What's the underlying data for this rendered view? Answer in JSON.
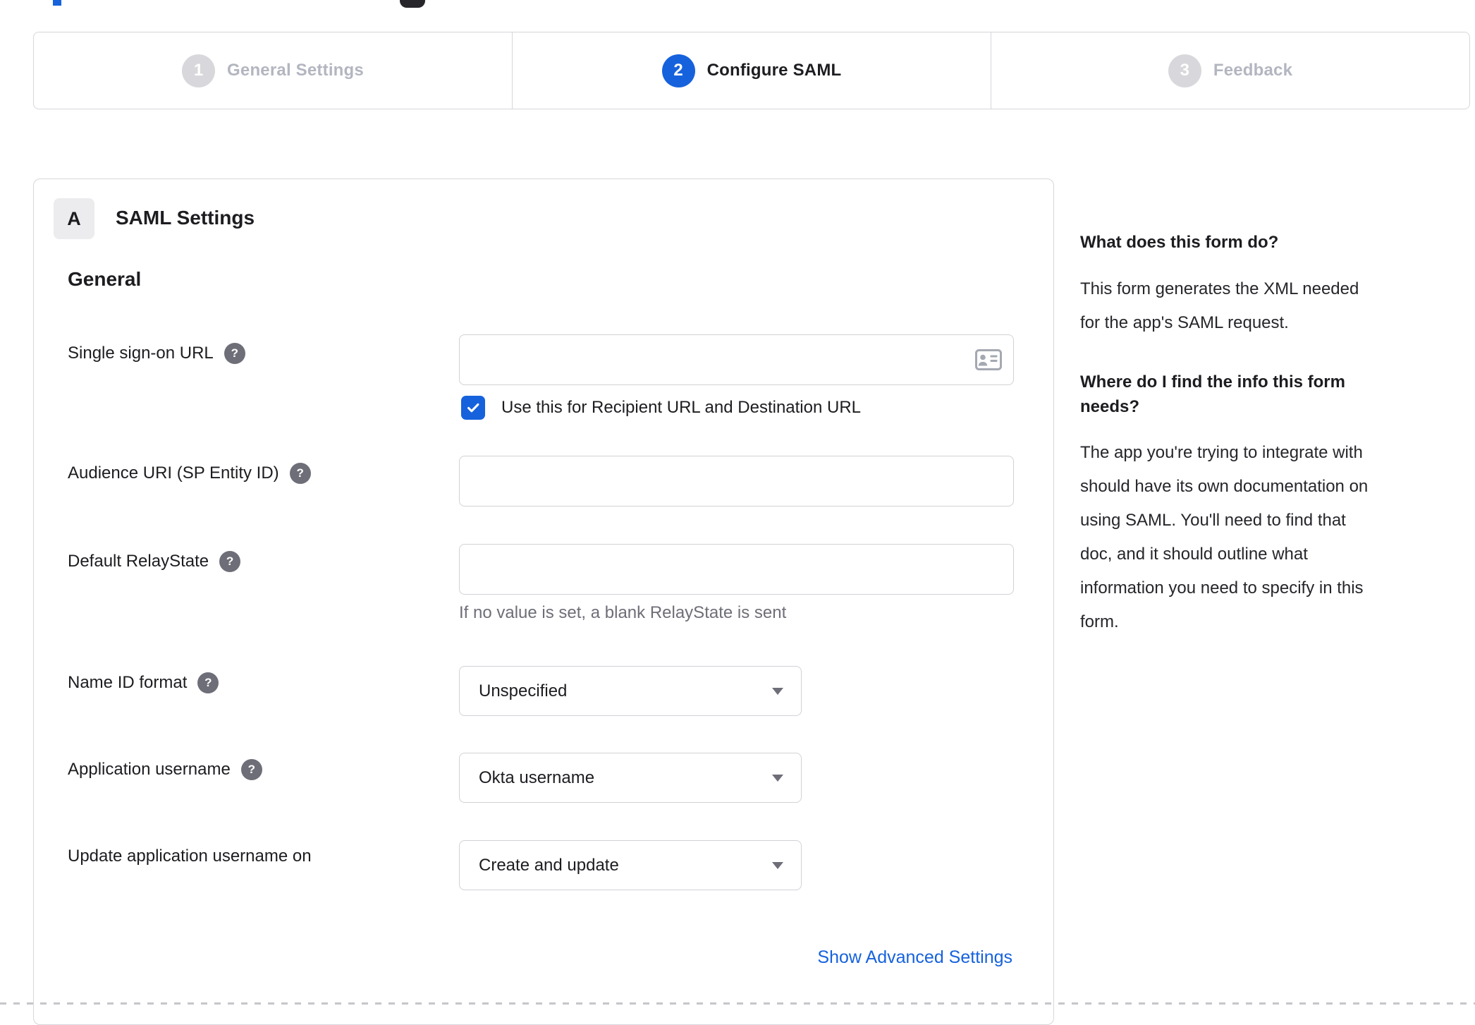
{
  "colors": {
    "accent_blue": "#1662dd",
    "text_dark": "#1d1d21",
    "muted_gray": "#6e6e78",
    "border_gray": "#d7d7dc",
    "inactive_gray": "#b3b6c0"
  },
  "stepper": {
    "active_step": "2",
    "steps": [
      {
        "number": "1",
        "label": "General Settings"
      },
      {
        "number": "2",
        "label": "Configure SAML"
      },
      {
        "number": "3",
        "label": "Feedback"
      }
    ]
  },
  "saml_panel": {
    "badge": "A",
    "title": "SAML Settings",
    "section_heading": "General",
    "sso_url": {
      "label": "Single sign-on URL",
      "value": ""
    },
    "sso_checkbox": {
      "label": "Use this for Recipient URL and Destination URL",
      "checked": "true"
    },
    "audience_uri": {
      "label": "Audience URI (SP Entity ID)",
      "value": ""
    },
    "relay_state": {
      "label": "Default RelayState",
      "value": "",
      "hint": "If no value is set, a blank RelayState is sent"
    },
    "name_id_format": {
      "label": "Name ID format",
      "value": "Unspecified"
    },
    "app_username": {
      "label": "Application username",
      "value": "Okta username"
    },
    "update_username": {
      "label": "Update application username on",
      "value": "Create and update"
    },
    "advanced_link": "Show Advanced Settings"
  },
  "help_panel": {
    "q1": {
      "heading": "What does this form do?",
      "lines": [
        "This form generates the XML needed",
        "for the app's SAML request."
      ]
    },
    "q2": {
      "heading_lines": [
        "Where do I find the info this form",
        "needs?"
      ],
      "lines": [
        "The app you're trying to integrate with",
        "should have its own documentation on",
        "using SAML. You'll need to find that",
        "doc, and it should outline what",
        "information you need to specify in this",
        "form."
      ]
    }
  }
}
